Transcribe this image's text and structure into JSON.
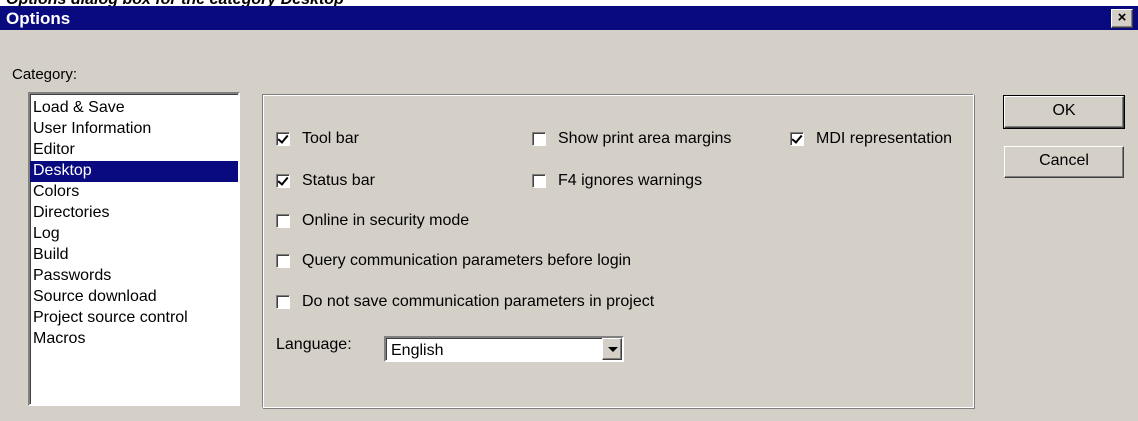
{
  "caption": "Options dialog box for the category Desktop",
  "window": {
    "title": "Options",
    "close_glyph": "×"
  },
  "category": {
    "label": "Category:",
    "items": [
      "Load & Save",
      "User Information",
      "Editor",
      "Desktop",
      "Colors",
      "Directories",
      "Log",
      "Build",
      "Passwords",
      "Source download",
      "Project source control",
      "Macros"
    ],
    "selected": "Desktop"
  },
  "options": {
    "tool_bar": {
      "label": "Tool bar",
      "checked": true
    },
    "status_bar": {
      "label": "Status bar",
      "checked": true
    },
    "online_security": {
      "label": "Online in security mode",
      "checked": false
    },
    "query_comm": {
      "label": "Query communication parameters before login",
      "checked": false
    },
    "no_save_comm": {
      "label": "Do not save communication parameters in project",
      "checked": false
    },
    "print_margins": {
      "label": "Show print area margins",
      "checked": false
    },
    "f4_ignores": {
      "label": "F4 ignores warnings",
      "checked": false
    },
    "mdi": {
      "label": "MDI representation",
      "checked": true
    }
  },
  "language": {
    "label": "Language:",
    "value": "English"
  },
  "buttons": {
    "ok": "OK",
    "cancel": "Cancel"
  },
  "colors": {
    "title_bar": "#0a0a80",
    "dialog_bg": "#d4d0c8",
    "selection": "#0a0a80"
  }
}
